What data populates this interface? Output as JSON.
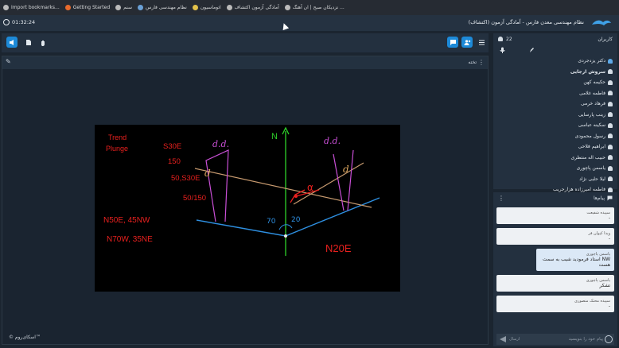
{
  "bookmarks": [
    {
      "label": "Import bookmarks..."
    },
    {
      "label": "Getting Started"
    },
    {
      "label": "سنم"
    },
    {
      "label": "نظام مهندسی فارس"
    },
    {
      "label": "اتوماسیون"
    },
    {
      "label": "آمادگی آزمون اکتشاف"
    },
    {
      "label": "نزدیکان صبح | ان آهنگ ..."
    }
  ],
  "header": {
    "timer": "01:32:24",
    "title": "نظام مهندسی معدن فارس - آمادگی آزمون (اکتشاف)"
  },
  "whiteboard": {
    "tab_title": "تخته",
    "brand": "© اسکای‌روم™"
  },
  "drawing": {
    "trend": "Trend",
    "plunge": "Plunge",
    "s30e": "S30E",
    "v150": "150",
    "v50s30e": "50,S30E",
    "v50_150": "50/150",
    "n50e": "N50E, 45NW",
    "n70w": "N70W, 35NE",
    "north": "N",
    "n20e": "N20E",
    "dd1": "d.d.",
    "dd2": "d.d.",
    "alpha": "α",
    "d1": "d",
    "d2": "d",
    "a20": "20",
    "a70": "70"
  },
  "users": {
    "header": "کاربران",
    "count": "22",
    "list": [
      {
        "name": "دکتر یزدجردی",
        "bold": false
      },
      {
        "name": "سروش ارجایی",
        "bold": true
      },
      {
        "name": "حکیمه کهن",
        "bold": false
      },
      {
        "name": "فاطمه غلامی",
        "bold": false
      },
      {
        "name": "فرهاد خرمی",
        "bold": false
      },
      {
        "name": "زینب پارسایی",
        "bold": false
      },
      {
        "name": "سکینه عباسی",
        "bold": false
      },
      {
        "name": "رسول محمودی",
        "bold": false
      },
      {
        "name": "ابراهیم فلاحی",
        "bold": false
      },
      {
        "name": "حبیب اله منتظری",
        "bold": false
      },
      {
        "name": "یاسمن پاچوری",
        "bold": false
      },
      {
        "name": "لیلا حلبی نژاد",
        "bold": false
      },
      {
        "name": "فاطمه امیرزاده هزارجریب",
        "bold": false
      }
    ]
  },
  "chat": {
    "header": "پیام‌ها",
    "messages": [
      {
        "sender": "سپیده شفیعت",
        "text": "-"
      },
      {
        "sender": "ویدا کیوان فر",
        "text": "-"
      },
      {
        "sender": "یاسمن پاچوری",
        "text": "استاد فرمودید شیب به سمت NW هست"
      },
      {
        "sender": "یاسمن پاچوری",
        "text": "تشکر"
      },
      {
        "sender": "سپیده محنک منصوری",
        "text": "-"
      }
    ],
    "input_placeholder": "پیام خود را بنویسید",
    "send_label": "ارسال"
  }
}
